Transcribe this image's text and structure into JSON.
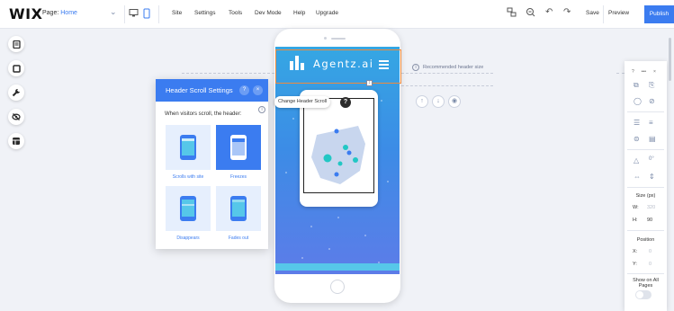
{
  "topbar": {
    "logo": "WIX",
    "page_label": "Page:",
    "page_name": "Home",
    "menu": [
      "Site",
      "Settings",
      "Tools",
      "Dev Mode",
      "Help",
      "Upgrade"
    ],
    "save": "Save",
    "preview": "Preview",
    "publish": "Publish"
  },
  "canvas": {
    "recommended_label": "Recommended header size",
    "brand_text": "Agentz.ai",
    "tooltip": "Change Header Scroll",
    "help": "?"
  },
  "panel": {
    "title": "Header Scroll Settings",
    "subtitle": "When visitors scroll, the header:",
    "options": [
      {
        "label": "Scrolls with site",
        "selected": false
      },
      {
        "label": "Freezes",
        "selected": true
      },
      {
        "label": "Disappears",
        "selected": false
      },
      {
        "label": "Fades out",
        "selected": false
      }
    ]
  },
  "right_panel": {
    "top": [
      "?",
      "•••",
      "×"
    ],
    "size_label": "Size (px)",
    "w_label": "W:",
    "w_value": "320",
    "h_label": "H:",
    "h_value": "90",
    "position_label": "Position",
    "x_label": "X:",
    "x_value": "0",
    "y_label": "Y:",
    "y_value": "0",
    "show_all_line1": "Show on All",
    "show_all_line2": "Pages",
    "show_all_on": false
  },
  "colors": {
    "accent": "#3b7cf0",
    "selection": "#f08a3c"
  }
}
